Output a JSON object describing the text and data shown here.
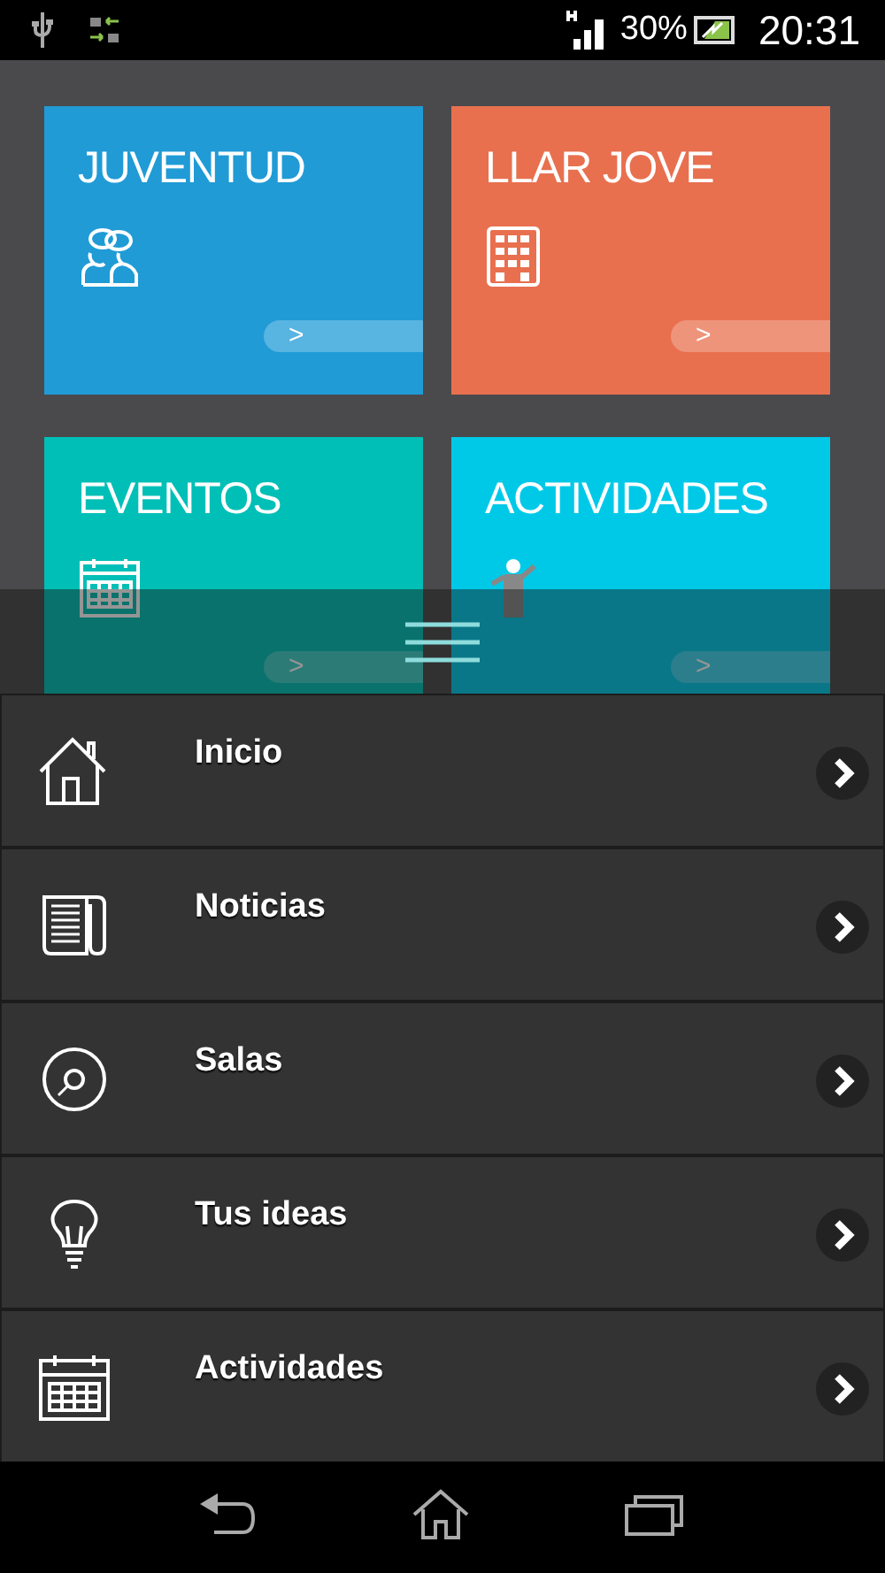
{
  "status_bar": {
    "battery": "30%",
    "time": "20:31"
  },
  "tiles": [
    {
      "title": "JUVENTUD",
      "color": "#209bd6",
      "kind": "people",
      "arrow": ">"
    },
    {
      "title": "LLAR JOVE",
      "color": "#e8704f",
      "kind": "building",
      "arrow": ">"
    },
    {
      "title": "EVENTOS",
      "color": "#00bfb6",
      "kind": "calendar",
      "arrow": ">"
    },
    {
      "title": "ACTIVIDADES",
      "color": "#00c9e8",
      "kind": "speaker",
      "arrow": ">"
    }
  ],
  "menu": [
    {
      "label": "Inicio",
      "kind": "home"
    },
    {
      "label": "Noticias",
      "kind": "news"
    },
    {
      "label": "Salas",
      "kind": "disc"
    },
    {
      "label": "Tus ideas",
      "kind": "bulb"
    },
    {
      "label": "Actividades",
      "kind": "calendar"
    }
  ]
}
